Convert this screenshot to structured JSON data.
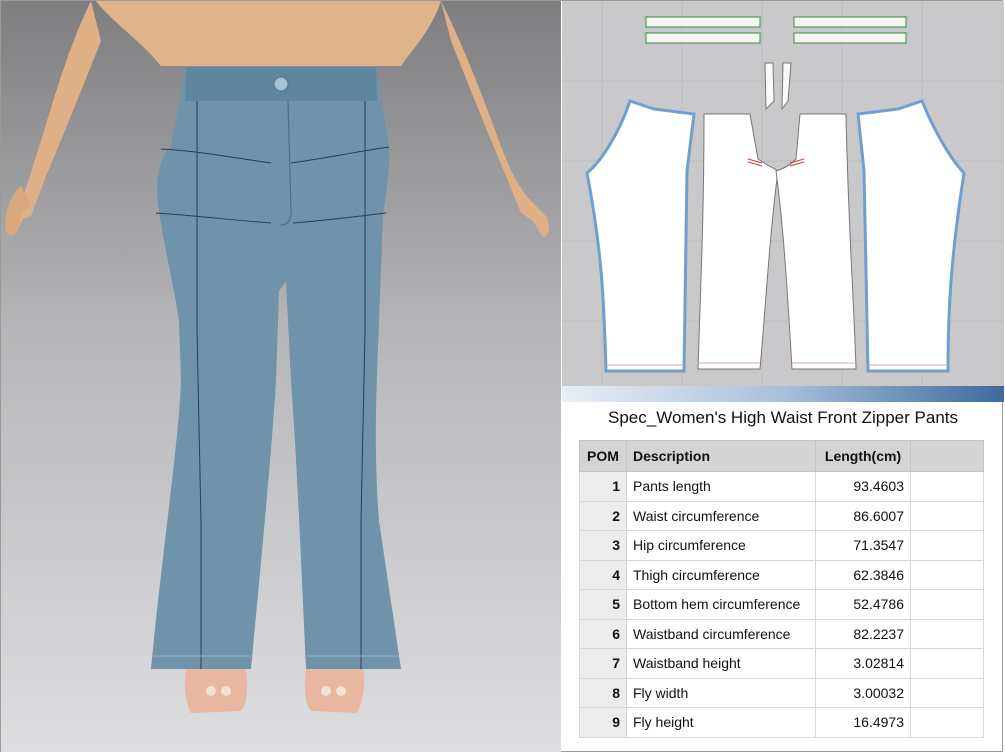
{
  "spec": {
    "title": "Spec_Women's High Waist Front Zipper Pants",
    "columns": {
      "pom": "POM",
      "description": "Description",
      "length": "Length(cm)",
      "extra": ""
    },
    "rows": [
      {
        "pom": "1",
        "description": "Pants length",
        "length": "93.4603"
      },
      {
        "pom": "2",
        "description": "Waist circumference",
        "length": "86.6007"
      },
      {
        "pom": "3",
        "description": "Hip circumference",
        "length": "71.3547"
      },
      {
        "pom": "4",
        "description": "Thigh circumference",
        "length": "62.3846"
      },
      {
        "pom": "5",
        "description": "Bottom hem circumference",
        "length": "52.4786"
      },
      {
        "pom": "6",
        "description": "Waistband circumference",
        "length": "82.2237"
      },
      {
        "pom": "7",
        "description": "Waistband height",
        "length": "3.02814"
      },
      {
        "pom": "8",
        "description": "Fly width",
        "length": "3.00032"
      },
      {
        "pom": "9",
        "description": "Fly height",
        "length": "16.4973"
      }
    ]
  },
  "colors": {
    "fabric": "#6e93ab",
    "skin": "#e3b98f",
    "pattern_bg": "#c9c9cc",
    "outline_blue": "#6f9fd0"
  }
}
